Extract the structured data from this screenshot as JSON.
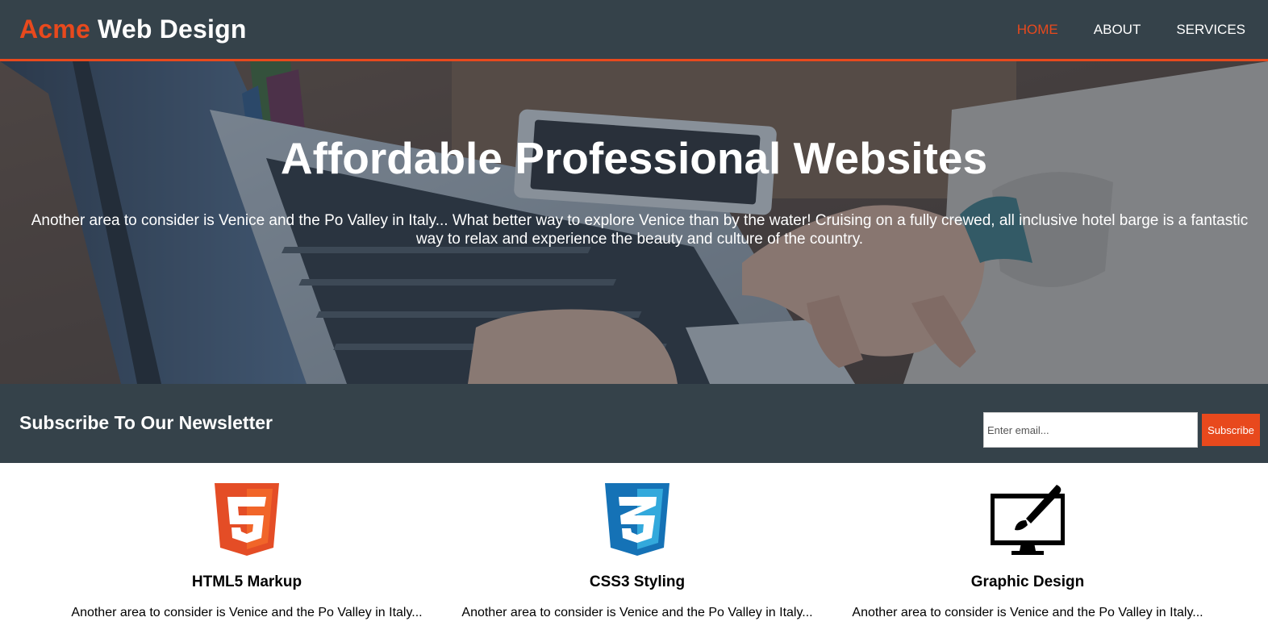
{
  "header": {
    "brand_highlight": "Acme",
    "brand_rest": " Web Design",
    "nav": [
      {
        "label": "HOME",
        "current": true
      },
      {
        "label": "ABOUT",
        "current": false
      },
      {
        "label": "SERVICES",
        "current": false
      }
    ]
  },
  "showcase": {
    "title": "Affordable Professional Websites",
    "text": "Another area to consider is Venice and the Po Valley in Italy... What better way to explore Venice than by the water! Cruising on a fully crewed, all inclusive hotel barge is a fantastic way to relax and experience the beauty and culture of the country."
  },
  "newsletter": {
    "title": "Subscribe To Our Newsletter",
    "email_placeholder": "Enter email...",
    "email_value": "",
    "button_label": "Subscribe"
  },
  "boxes": [
    {
      "icon": "html5-logo-icon",
      "title": "HTML5 Markup",
      "text": "Another area to consider is Venice and the Po Valley in Italy..."
    },
    {
      "icon": "css3-logo-icon",
      "title": "CSS3 Styling",
      "text": "Another area to consider is Venice and the Po Valley in Italy..."
    },
    {
      "icon": "graphic-design-monitor-icon",
      "title": "Graphic Design",
      "text": "Another area to consider is Venice and the Po Valley in Italy..."
    }
  ],
  "colors": {
    "accent": "#e8491d",
    "dark": "#35424a",
    "html5": "#e44d26",
    "css3": "#1572b6"
  }
}
